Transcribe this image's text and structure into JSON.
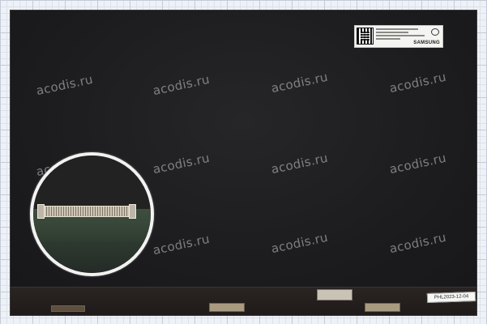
{
  "watermark": {
    "text": "acodis.ru"
  },
  "sticker": {
    "brand": "SAMSUNG"
  },
  "side_label": {
    "text": "PHL2023-12-04"
  },
  "colors": {
    "panel": "#1c1c1e",
    "background_grid": "#c3cbd8",
    "watermark": "#cdcdcd"
  }
}
